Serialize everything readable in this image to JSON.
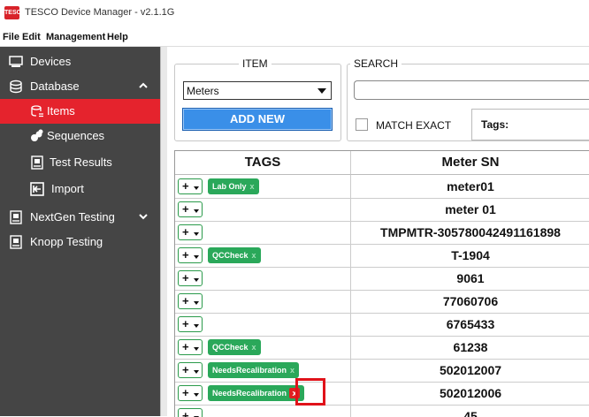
{
  "window": {
    "title": "TESCO Device Manager - v2.1.1G",
    "logo_text": "TESCO"
  },
  "menu": [
    "File",
    "Edit",
    "Management",
    "Help"
  ],
  "sidebar": {
    "items": [
      {
        "label": "Devices",
        "icon": "devices-icon"
      },
      {
        "label": "Database",
        "icon": "database-icon",
        "expanded": true
      },
      {
        "label": "Items",
        "icon": "items-icon",
        "active": true
      },
      {
        "label": "Sequences",
        "icon": "sequences-icon"
      },
      {
        "label": "Test Results",
        "icon": "test-results-icon"
      },
      {
        "label": "Import",
        "icon": "import-icon"
      },
      {
        "label": "NextGen Testing",
        "icon": "nextgen-testing-icon"
      },
      {
        "label": "Knopp Testing",
        "icon": "knopp-testing-icon"
      }
    ]
  },
  "item_group": {
    "label": "ITEM",
    "selected": "Meters",
    "add_new": "ADD NEW"
  },
  "search_group": {
    "label": "SEARCH",
    "value": "",
    "match_exact": "MATCH EXACT",
    "match_exact_checked": false,
    "tags_label": "Tags:"
  },
  "table": {
    "headers": [
      "TAGS",
      "Meter SN"
    ],
    "add_tag_symbol": "+",
    "remove_symbol": "x",
    "rows": [
      {
        "tag": "Lab Only",
        "sn": "meter01"
      },
      {
        "tag": "",
        "sn": "meter 01"
      },
      {
        "tag": "",
        "sn": "TMPMTR-305780042491161898"
      },
      {
        "tag": "QCCheck",
        "sn": "T-1904"
      },
      {
        "tag": "",
        "sn": "9061"
      },
      {
        "tag": "",
        "sn": "77060706"
      },
      {
        "tag": "",
        "sn": "6765433"
      },
      {
        "tag": "QCCheck",
        "sn": "61238"
      },
      {
        "tag": "NeedsRecalibration",
        "sn": "502012007"
      },
      {
        "tag": "NeedsRecalibration",
        "sn": "502012006",
        "highlight": true
      },
      {
        "tag": "",
        "sn": "45"
      }
    ]
  },
  "colors": {
    "accent_red": "#e5232d",
    "sidebar_bg": "#454545",
    "tag_green": "#2aa85a",
    "button_blue": "#3a8fe8",
    "highlight_red": "#e0121a"
  }
}
